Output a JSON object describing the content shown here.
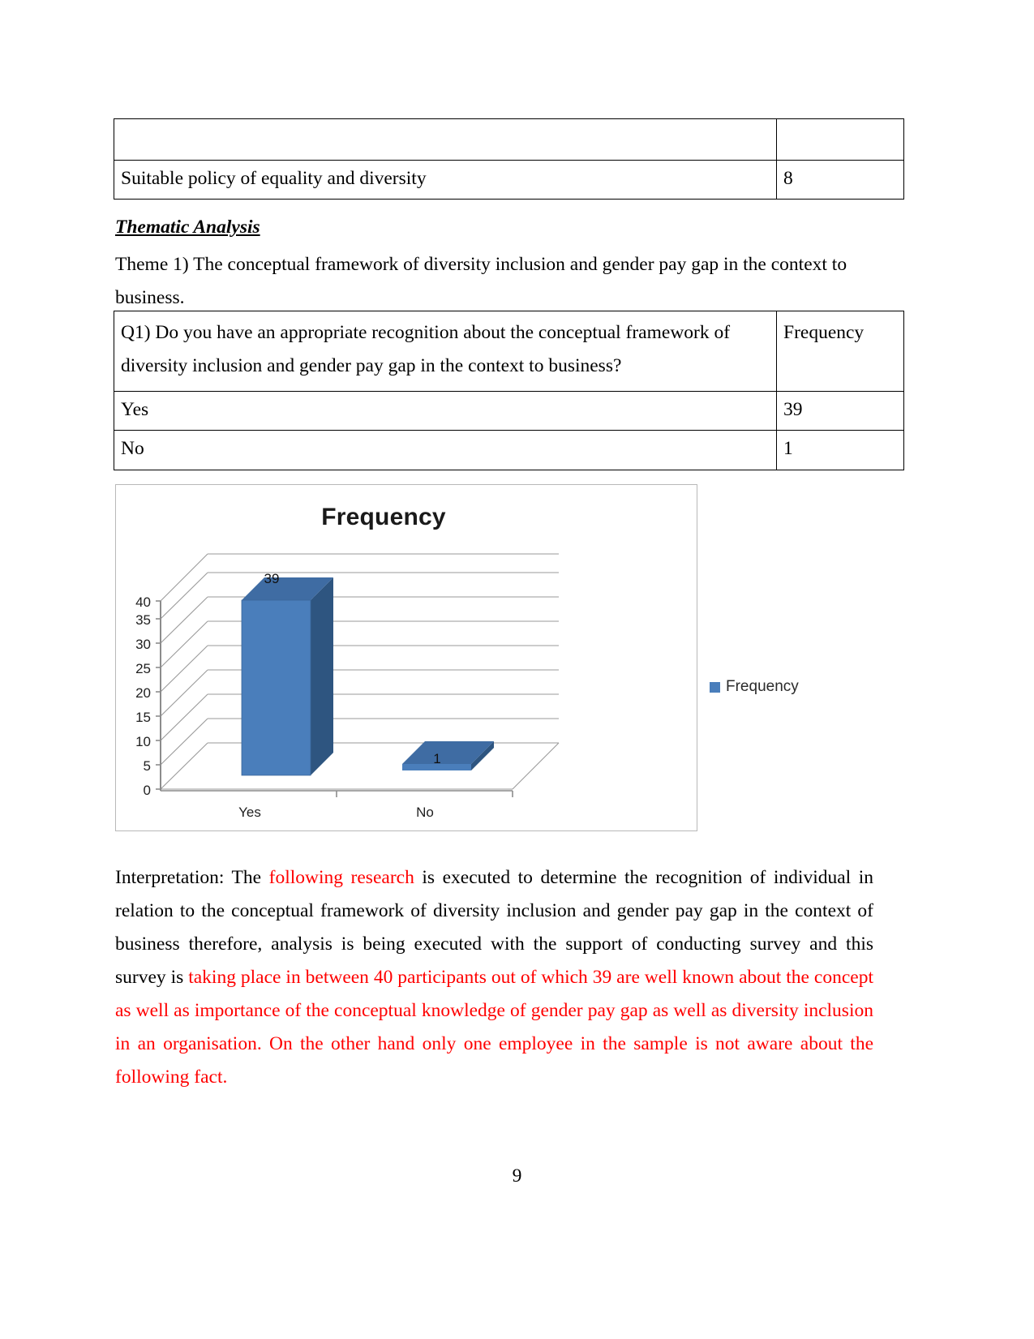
{
  "document": {
    "page_number": "9",
    "top_table": {
      "rows": [
        {
          "label": "",
          "value": ""
        },
        {
          "label": "Suitable policy of equality and diversity",
          "value": "8"
        }
      ]
    },
    "headings": {
      "thematic_analysis": "Thematic Analysis ",
      "theme_intro": "Theme 1) The conceptual framework of diversity inclusion and gender pay gap in the context to business."
    },
    "question_table": {
      "question": "Q1) Do you have an appropriate recognition about the conceptual framework of diversity inclusion and gender pay gap in the context to business?",
      "frequency_header": "Frequency",
      "rows": [
        {
          "label": "Yes",
          "value": "39"
        },
        {
          "label": "No",
          "value": "1"
        }
      ]
    },
    "interpretation": {
      "prefix_black_1": "Interpretation: The ",
      "red_1": "following research",
      "black_2": " is executed to determine the recognition of individual in relation to the conceptual framework of diversity inclusion and gender pay gap in the context of business therefore, analysis is being executed with the support of conducting survey and this survey is ",
      "red_2": "taking place in between 40 participants out of which 39 are well known about the concept as well as importance of the conceptual knowledge of gender pay gap as well as diversity inclusion in an organisation. On the other hand only one employee in the sample is not aware about the following fact."
    }
  },
  "chart_data": {
    "type": "bar",
    "title": "Frequency",
    "categories": [
      "Yes",
      "No"
    ],
    "values": [
      39,
      1
    ],
    "data_labels": [
      "39",
      "1"
    ],
    "series": [
      {
        "name": "Frequency",
        "values": [
          39,
          1
        ]
      }
    ],
    "legend": {
      "entries": [
        "Frequency"
      ],
      "position": "right"
    },
    "xlabel": "",
    "ylabel": "",
    "ylim": [
      0,
      40
    ],
    "yticks": [
      "0",
      "5",
      "10",
      "15",
      "20",
      "25",
      "30",
      "35",
      "40"
    ],
    "grid": true,
    "three_d": true,
    "colors": {
      "bar_front": "#4a7ebb",
      "bar_top": "#3f6ca3",
      "bar_side": "#2e5580",
      "gridline": "#9a9a9a",
      "axis": "#8c8c8c",
      "border": "#b8b8b8"
    }
  }
}
